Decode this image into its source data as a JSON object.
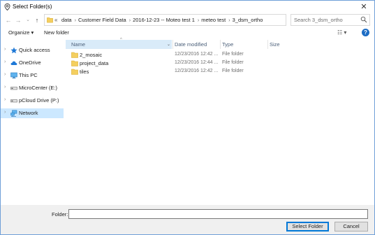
{
  "window": {
    "title": "Select Folder(s)",
    "close_glyph": "✕",
    "accent_color": "#0078d7",
    "selection_color": "#cce8ff"
  },
  "nav": {
    "back_glyph": "←",
    "forward_glyph": "→",
    "recent_glyph": "⌄",
    "up_glyph": "↑"
  },
  "address": {
    "overflow_glyph": "«",
    "separator": "›",
    "crumbs": [
      "data",
      "Customer Field Data",
      "2016-12-23 -- Moteo test 1",
      "meteo test",
      "3_dsm_ortho"
    ],
    "dropdown_glyph": "⌄",
    "refresh_glyph": "↻"
  },
  "search": {
    "placeholder": "Search 3_dsm_ortho"
  },
  "toolbar": {
    "organize_label": "Organize ▾",
    "new_folder_label": "New folder",
    "view_glyph": "☷ ▾",
    "help_glyph": "?"
  },
  "sidebar": {
    "items": [
      {
        "label": "Quick access",
        "icon": "star-icon",
        "chevron": "›"
      },
      {
        "label": "OneDrive",
        "icon": "cloud-icon",
        "chevron": "›"
      },
      {
        "label": "This PC",
        "icon": "monitor-icon",
        "chevron": "›"
      },
      {
        "label": "MicroCenter (E:)",
        "icon": "drive-icon",
        "chevron": "›"
      },
      {
        "label": "pCloud Drive (P:)",
        "icon": "drive-icon",
        "chevron": "›"
      },
      {
        "label": "Network",
        "icon": "network-icon",
        "chevron": "›",
        "selected": true
      }
    ]
  },
  "file_list": {
    "sort_glyph": "^",
    "name_dropdown_glyph": "⌄",
    "columns": [
      "Name",
      "Date modified",
      "Type",
      "Size"
    ],
    "rows": [
      {
        "name": "2_mosaic",
        "date": "12/23/2016 12:42 ...",
        "type": "File folder"
      },
      {
        "name": "project_data",
        "date": "12/23/2016 12:44 ...",
        "type": "File folder"
      },
      {
        "name": "tiles",
        "date": "12/23/2016 12:42 ...",
        "type": "File folder"
      }
    ]
  },
  "footer": {
    "folder_label": "Folder:",
    "folder_value": "",
    "select_label": "Select Folder",
    "cancel_label": "Cancel"
  }
}
